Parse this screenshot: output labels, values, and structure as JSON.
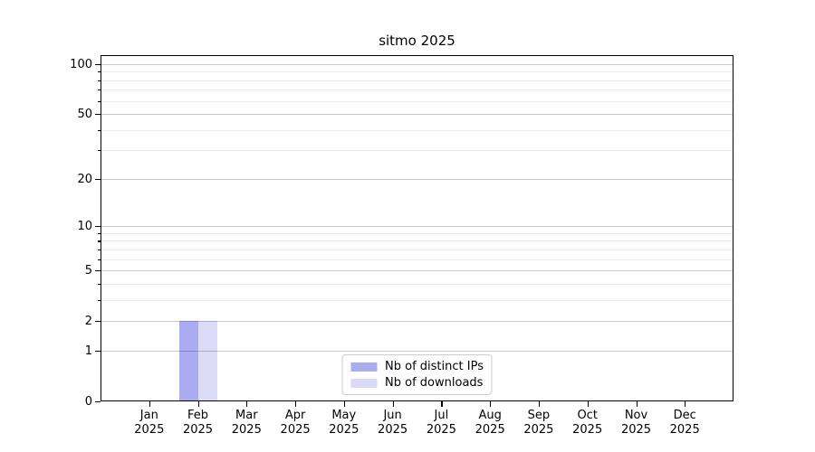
{
  "chart_data": {
    "type": "bar",
    "title": "sitmo 2025",
    "categories": [
      "Jan\n2025",
      "Feb\n2025",
      "Mar\n2025",
      "Apr\n2025",
      "May\n2025",
      "Jun\n2025",
      "Jul\n2025",
      "Aug\n2025",
      "Sep\n2025",
      "Oct\n2025",
      "Nov\n2025",
      "Dec\n2025"
    ],
    "series": [
      {
        "name": "Nb of distinct IPs",
        "color": "rgba(0,0,215,0.33)",
        "color_hex": "#ababf2",
        "values": [
          0,
          2,
          0,
          0,
          0,
          0,
          0,
          0,
          0,
          0,
          0,
          0
        ]
      },
      {
        "name": "Nb of downloads",
        "color": "rgba(0,0,200,0.14)",
        "color_hex": "#dcdcf8",
        "values": [
          0,
          2,
          0,
          0,
          0,
          0,
          0,
          0,
          0,
          0,
          0,
          0
        ]
      }
    ],
    "xlabel": "",
    "ylabel": "",
    "yscale": "log1p",
    "yticks": [
      0,
      1,
      2,
      5,
      10,
      20,
      50,
      100
    ],
    "yticks_minor": [
      3,
      4,
      6,
      7,
      8,
      9,
      30,
      40,
      60,
      70,
      80,
      90
    ],
    "ylim": [
      0,
      113
    ],
    "grid": true,
    "legend_position": "lower center",
    "colors": {
      "grid_major": "#c9c9c9",
      "grid_minor": "#e9e9e9",
      "axis": "#000000",
      "legend_border": "#cccccc",
      "background": "#ffffff",
      "text": "#000000"
    }
  }
}
